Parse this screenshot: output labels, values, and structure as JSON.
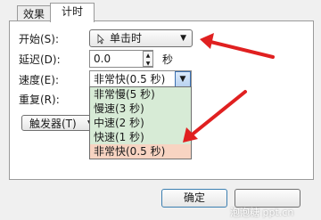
{
  "tabs": [
    {
      "label": "效果",
      "active": false
    },
    {
      "label": "计时",
      "active": true
    }
  ],
  "form": {
    "start_label": "开始(S):",
    "start_value": "单击时",
    "delay_label": "延迟(D):",
    "delay_value": "0.0",
    "delay_unit": "秒",
    "speed_label": "速度(E):",
    "speed_value": "非常快(0.5 秒)",
    "repeat_label": "重复(R):",
    "triggers_label": "触发器(T)"
  },
  "speed_options": [
    "非常慢(5 秒)",
    "慢速(3 秒)",
    "中速(2 秒)",
    "快速(1 秒)",
    "非常快(0.5 秒)"
  ],
  "speed_selected_index": 4,
  "footer": {
    "ok_label": "确定"
  },
  "watermark": "泡泡糖 ppt.cn",
  "colors": {
    "annotation_arrow": "#e02020",
    "dropdown_bg": "#d7ebd6",
    "selected_option_bg": "#f8d4c2"
  }
}
